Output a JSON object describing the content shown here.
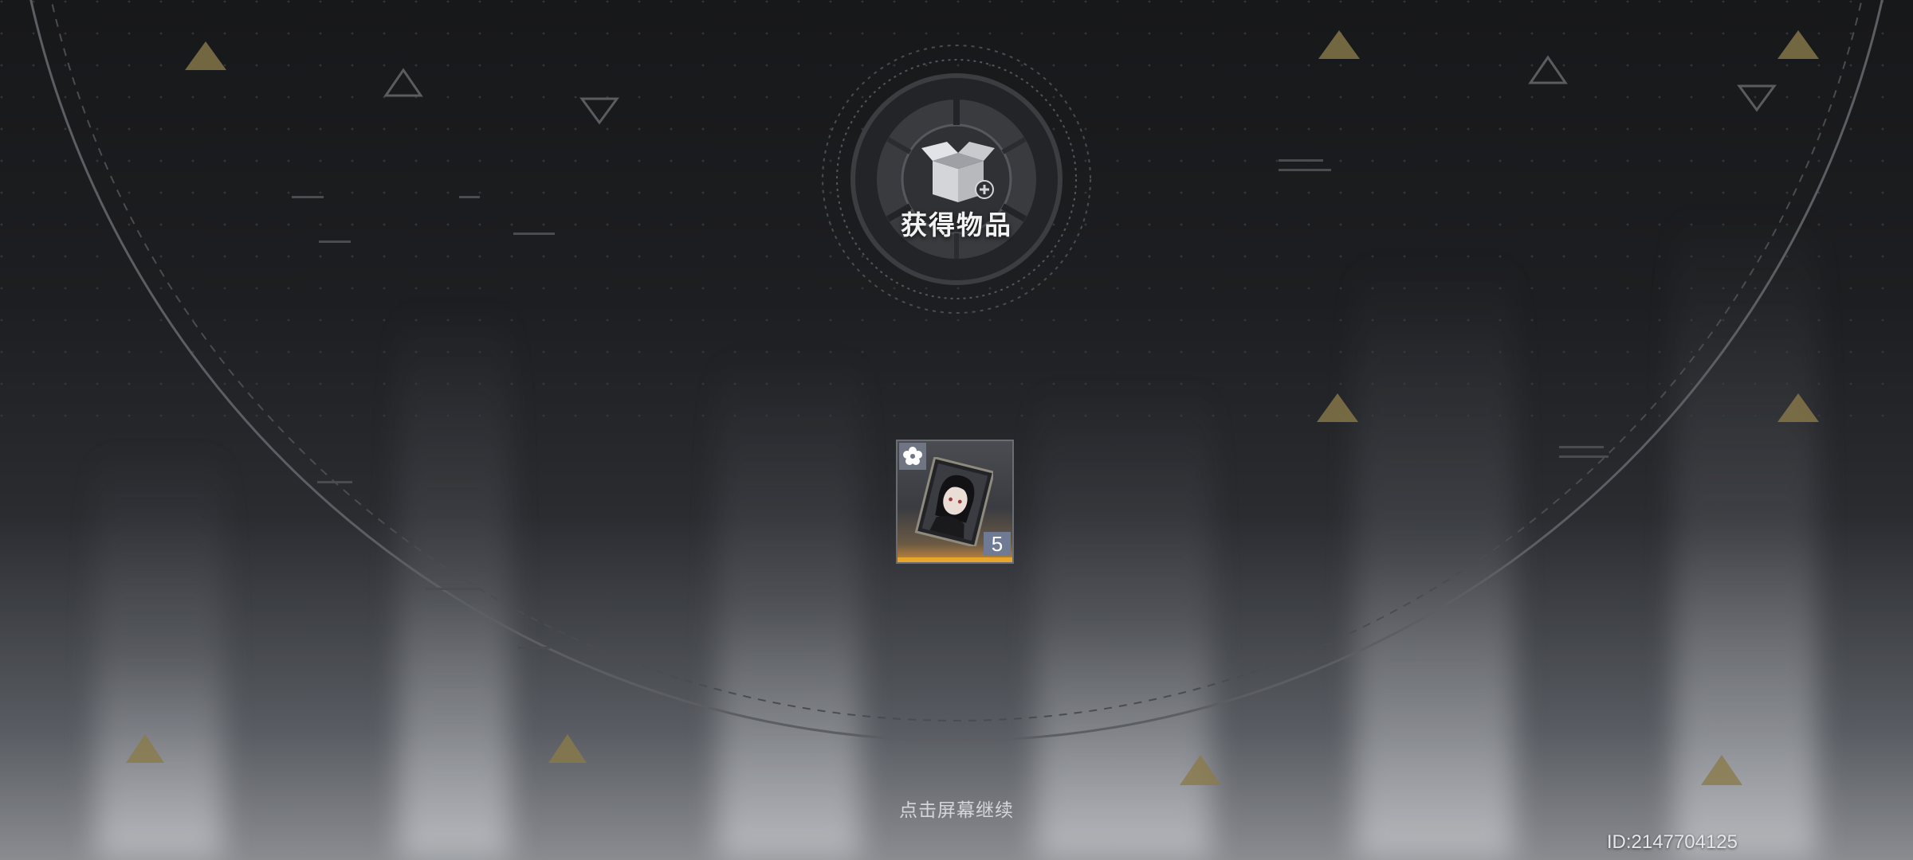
{
  "reward_screen": {
    "title": "获得物品",
    "emblem_icon": "box-plus-icon",
    "continue_hint": "点击屏幕继续",
    "player_id_label": "ID:2147704125"
  },
  "items": [
    {
      "name": "character-portrait-card",
      "type_icon": "flower-icon",
      "count": "5",
      "rarity_color": "#e7a52a"
    }
  ],
  "colors": {
    "accent_gold": "#8a7a4a",
    "rarity_bar": "#e7a52a",
    "count_badge": "#6f7a94"
  }
}
